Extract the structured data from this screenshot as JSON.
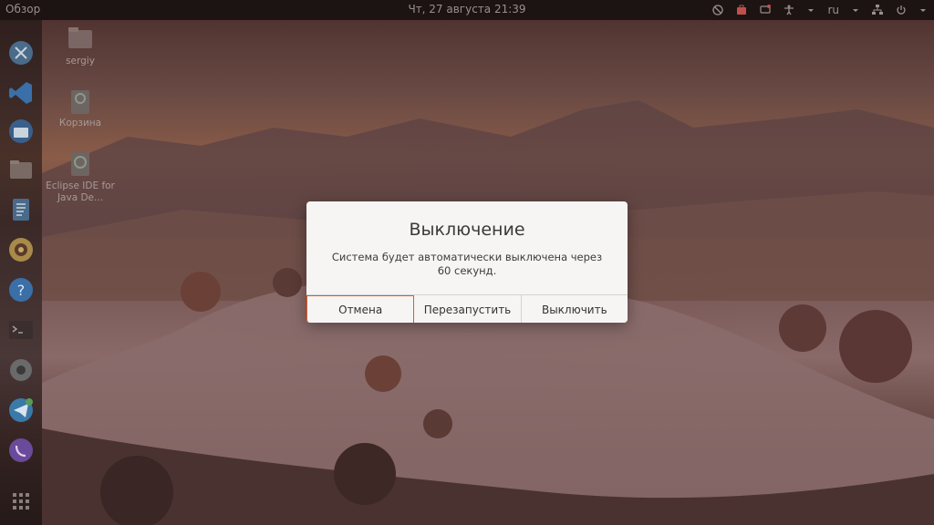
{
  "topbar": {
    "activities": "Обзор",
    "clock": "Чт, 27 августа  21:39",
    "language": "ru"
  },
  "desktop": {
    "icons": [
      {
        "label": "sergiy",
        "icon": "folder-icon"
      },
      {
        "label": "Корзина",
        "icon": "trash-icon"
      },
      {
        "label": "Eclipse IDE for Java De...",
        "icon": "eclipse-launcher-icon"
      }
    ]
  },
  "dock": {
    "items": [
      "terminal-app-icon",
      "vscode-icon",
      "thunderbird-icon",
      "files-icon",
      "text-editor-icon",
      "rhythmbox-icon",
      "help-icon",
      "terminal-icon",
      "settings-icon",
      "telegram-icon",
      "viber-icon",
      "show-apps-icon"
    ]
  },
  "dialog": {
    "title": "Выключение",
    "message": "Система будет автоматически выключена через 60 секунд.",
    "buttons": {
      "cancel": "Отмена",
      "restart": "Перезапустить",
      "shutdown": "Выключить"
    }
  },
  "colors": {
    "accent": "#e95420",
    "dialog_bg": "#f6f5f4"
  }
}
